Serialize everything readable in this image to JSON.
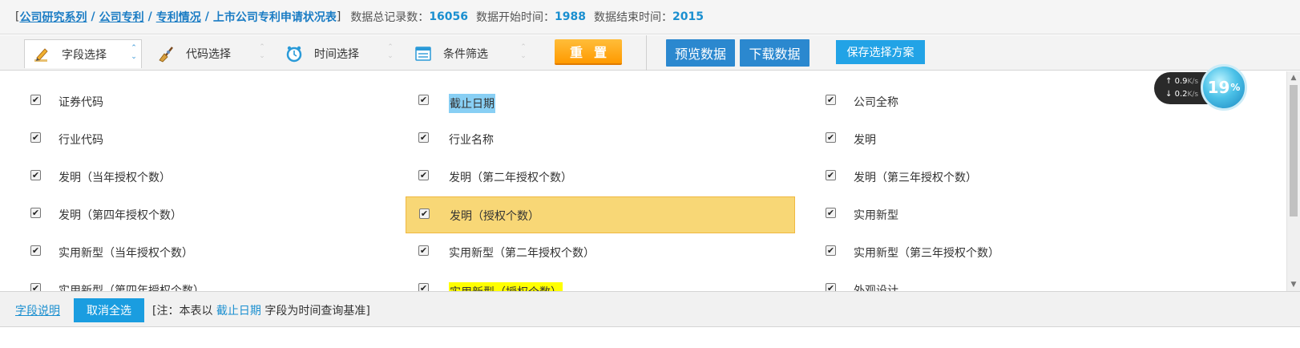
{
  "header": {
    "bracket_open": "[",
    "breadcrumbs": [
      "公司研究系列",
      "公司专利",
      "专利情况",
      "上市公司专利申请状况表"
    ],
    "separator": "/",
    "bracket_close": "]",
    "stats": [
      {
        "label": "数据总记录数：",
        "value": "16056"
      },
      {
        "label": "数据开始时间：",
        "value": "1988"
      },
      {
        "label": "数据结束时间：",
        "value": "2015"
      }
    ]
  },
  "toolbar": {
    "tabs": [
      {
        "label": "字段选择",
        "icon": "pencil-ruler-icon",
        "active": true
      },
      {
        "label": "代码选择",
        "icon": "broom-icon",
        "active": false
      },
      {
        "label": "时间选择",
        "icon": "alarm-clock-icon",
        "active": false
      },
      {
        "label": "条件筛选",
        "icon": "list-filter-icon",
        "active": false
      }
    ],
    "reset_label": "重置",
    "preview_label": "预览数据",
    "download_label": "下载数据",
    "save_label": "保存选择方案"
  },
  "fields": [
    {
      "label": "证券代码",
      "checked": true,
      "highlight": ""
    },
    {
      "label": "截止日期",
      "checked": true,
      "highlight": "blue"
    },
    {
      "label": "公司全称",
      "checked": true,
      "highlight": ""
    },
    {
      "label": "行业代码",
      "checked": true,
      "highlight": ""
    },
    {
      "label": "行业名称",
      "checked": true,
      "highlight": ""
    },
    {
      "label": "发明",
      "checked": true,
      "highlight": ""
    },
    {
      "label": "发明（当年授权个数）",
      "checked": true,
      "highlight": ""
    },
    {
      "label": "发明（第二年授权个数）",
      "checked": true,
      "highlight": ""
    },
    {
      "label": "发明（第三年授权个数）",
      "checked": true,
      "highlight": ""
    },
    {
      "label": "发明（第四年授权个数）",
      "checked": true,
      "highlight": ""
    },
    {
      "label": "发明（授权个数）",
      "checked": true,
      "highlight": "orange-row"
    },
    {
      "label": "实用新型",
      "checked": true,
      "highlight": ""
    },
    {
      "label": "实用新型（当年授权个数）",
      "checked": true,
      "highlight": ""
    },
    {
      "label": "实用新型（第二年授权个数）",
      "checked": true,
      "highlight": ""
    },
    {
      "label": "实用新型（第三年授权个数）",
      "checked": true,
      "highlight": ""
    },
    {
      "label": "实用新型（第四年授权个数）",
      "checked": true,
      "highlight": ""
    },
    {
      "label": "实用新型（授权个数）",
      "checked": true,
      "highlight": "yellow"
    },
    {
      "label": "外观设计",
      "checked": true,
      "highlight": ""
    }
  ],
  "footer": {
    "field_desc_link": "字段说明",
    "deselect_all": "取消全选",
    "note_prefix": "[注：本表以",
    "note_field": "截止日期",
    "note_suffix": "字段为时间查询基准]"
  },
  "net_widget": {
    "up_speed": "0.9",
    "down_speed": "0.2",
    "unit": "K/s",
    "percent": "19",
    "percent_sign": "%"
  },
  "colors": {
    "accent_blue": "#1a7cc4",
    "button_blue": "#2b88cf",
    "reset_orange": "#ff9a00",
    "row_highlight": "#f8d776",
    "label_blue_highlight": "#88cff4",
    "label_yellow_highlight": "#ffff00"
  }
}
